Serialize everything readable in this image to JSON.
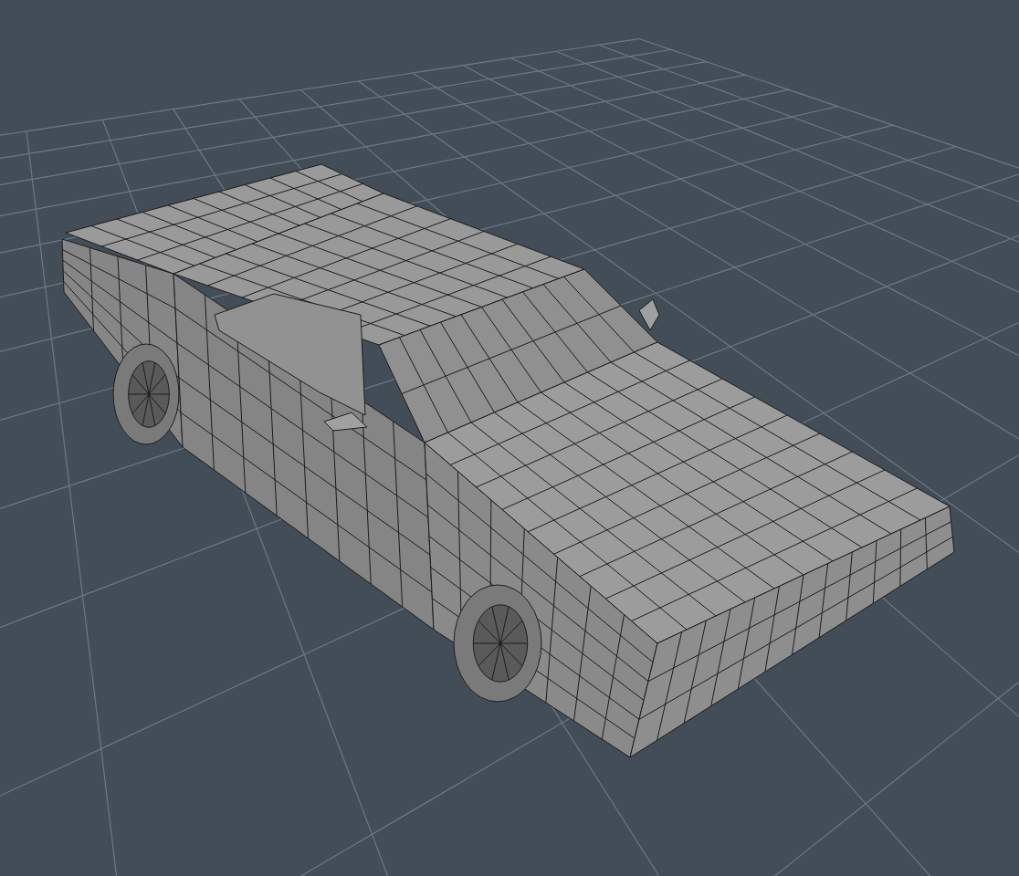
{
  "viewport": {
    "grid": true,
    "model": {
      "kind": "car",
      "wireframe": true
    }
  }
}
